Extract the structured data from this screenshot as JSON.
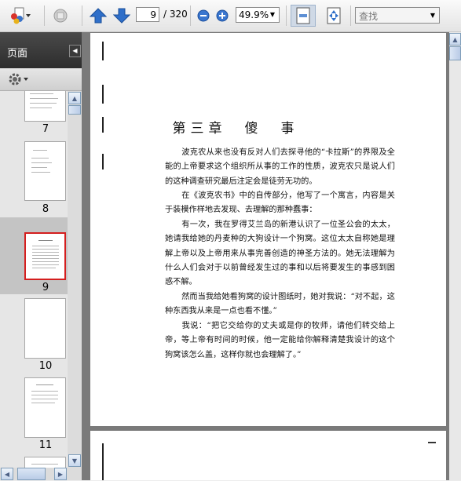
{
  "toolbar": {
    "page_current": "9",
    "page_total": "/ 320",
    "zoom_value": "49.9%",
    "find_placeholder": "查找"
  },
  "panel": {
    "title": "页面",
    "thumbnails": [
      {
        "label": "7"
      },
      {
        "label": "8"
      },
      {
        "label": "9",
        "selected": true
      },
      {
        "label": "10"
      },
      {
        "label": "11"
      }
    ]
  },
  "document": {
    "chapter_title": "第三章　傻　事",
    "paragraphs": [
      "波克农从来也没有反对人们去探寻他的“卡拉斯”的界限及全能的上帝要求这个组织所从事的工作的性质，波克农只是说人们的这种调查研究最后注定会是徒劳无功的。",
      "在《波克农书》中的自传部分，他写了一个寓言，内容是关于装模作样地去发现、去理解的那种蠢事：",
      "有一次，我在罗得艾兰岛的新港认识了一位圣公会的太太，她请我给她的丹麦种的大狗设计一个狗窝。这位太太自称她是理解上帝以及上帝用来从事完善创造的神圣方法的。她无法理解为什么人们会对于以前曾经发生过的事和以后将要发生的事感到困惑不解。",
      "然而当我给她看狗窝的设计图纸时，她对我说：“对不起，这种东西我从来是一点也看不懂。”",
      "我说：“把它交给你的丈夫或是你的牧师，请他们转交给上帝，等上帝有时间的时候，他一定能给你解释清楚我设计的这个狗窝该怎么盖，这样你就也会理解了。”"
    ]
  },
  "colors": {
    "toolbar_arrow": "#2f6fc9",
    "selected_thumb_border": "#d41e1e",
    "panel_header": "#333333",
    "doc_background": "#7a7a7a"
  },
  "icons": [
    "create-pdf-icon",
    "collaborate-icon",
    "previous-page-icon",
    "next-page-icon",
    "zoom-out-icon",
    "zoom-in-icon",
    "fit-page-icon",
    "full-screen-icon",
    "options-gear-icon"
  ]
}
